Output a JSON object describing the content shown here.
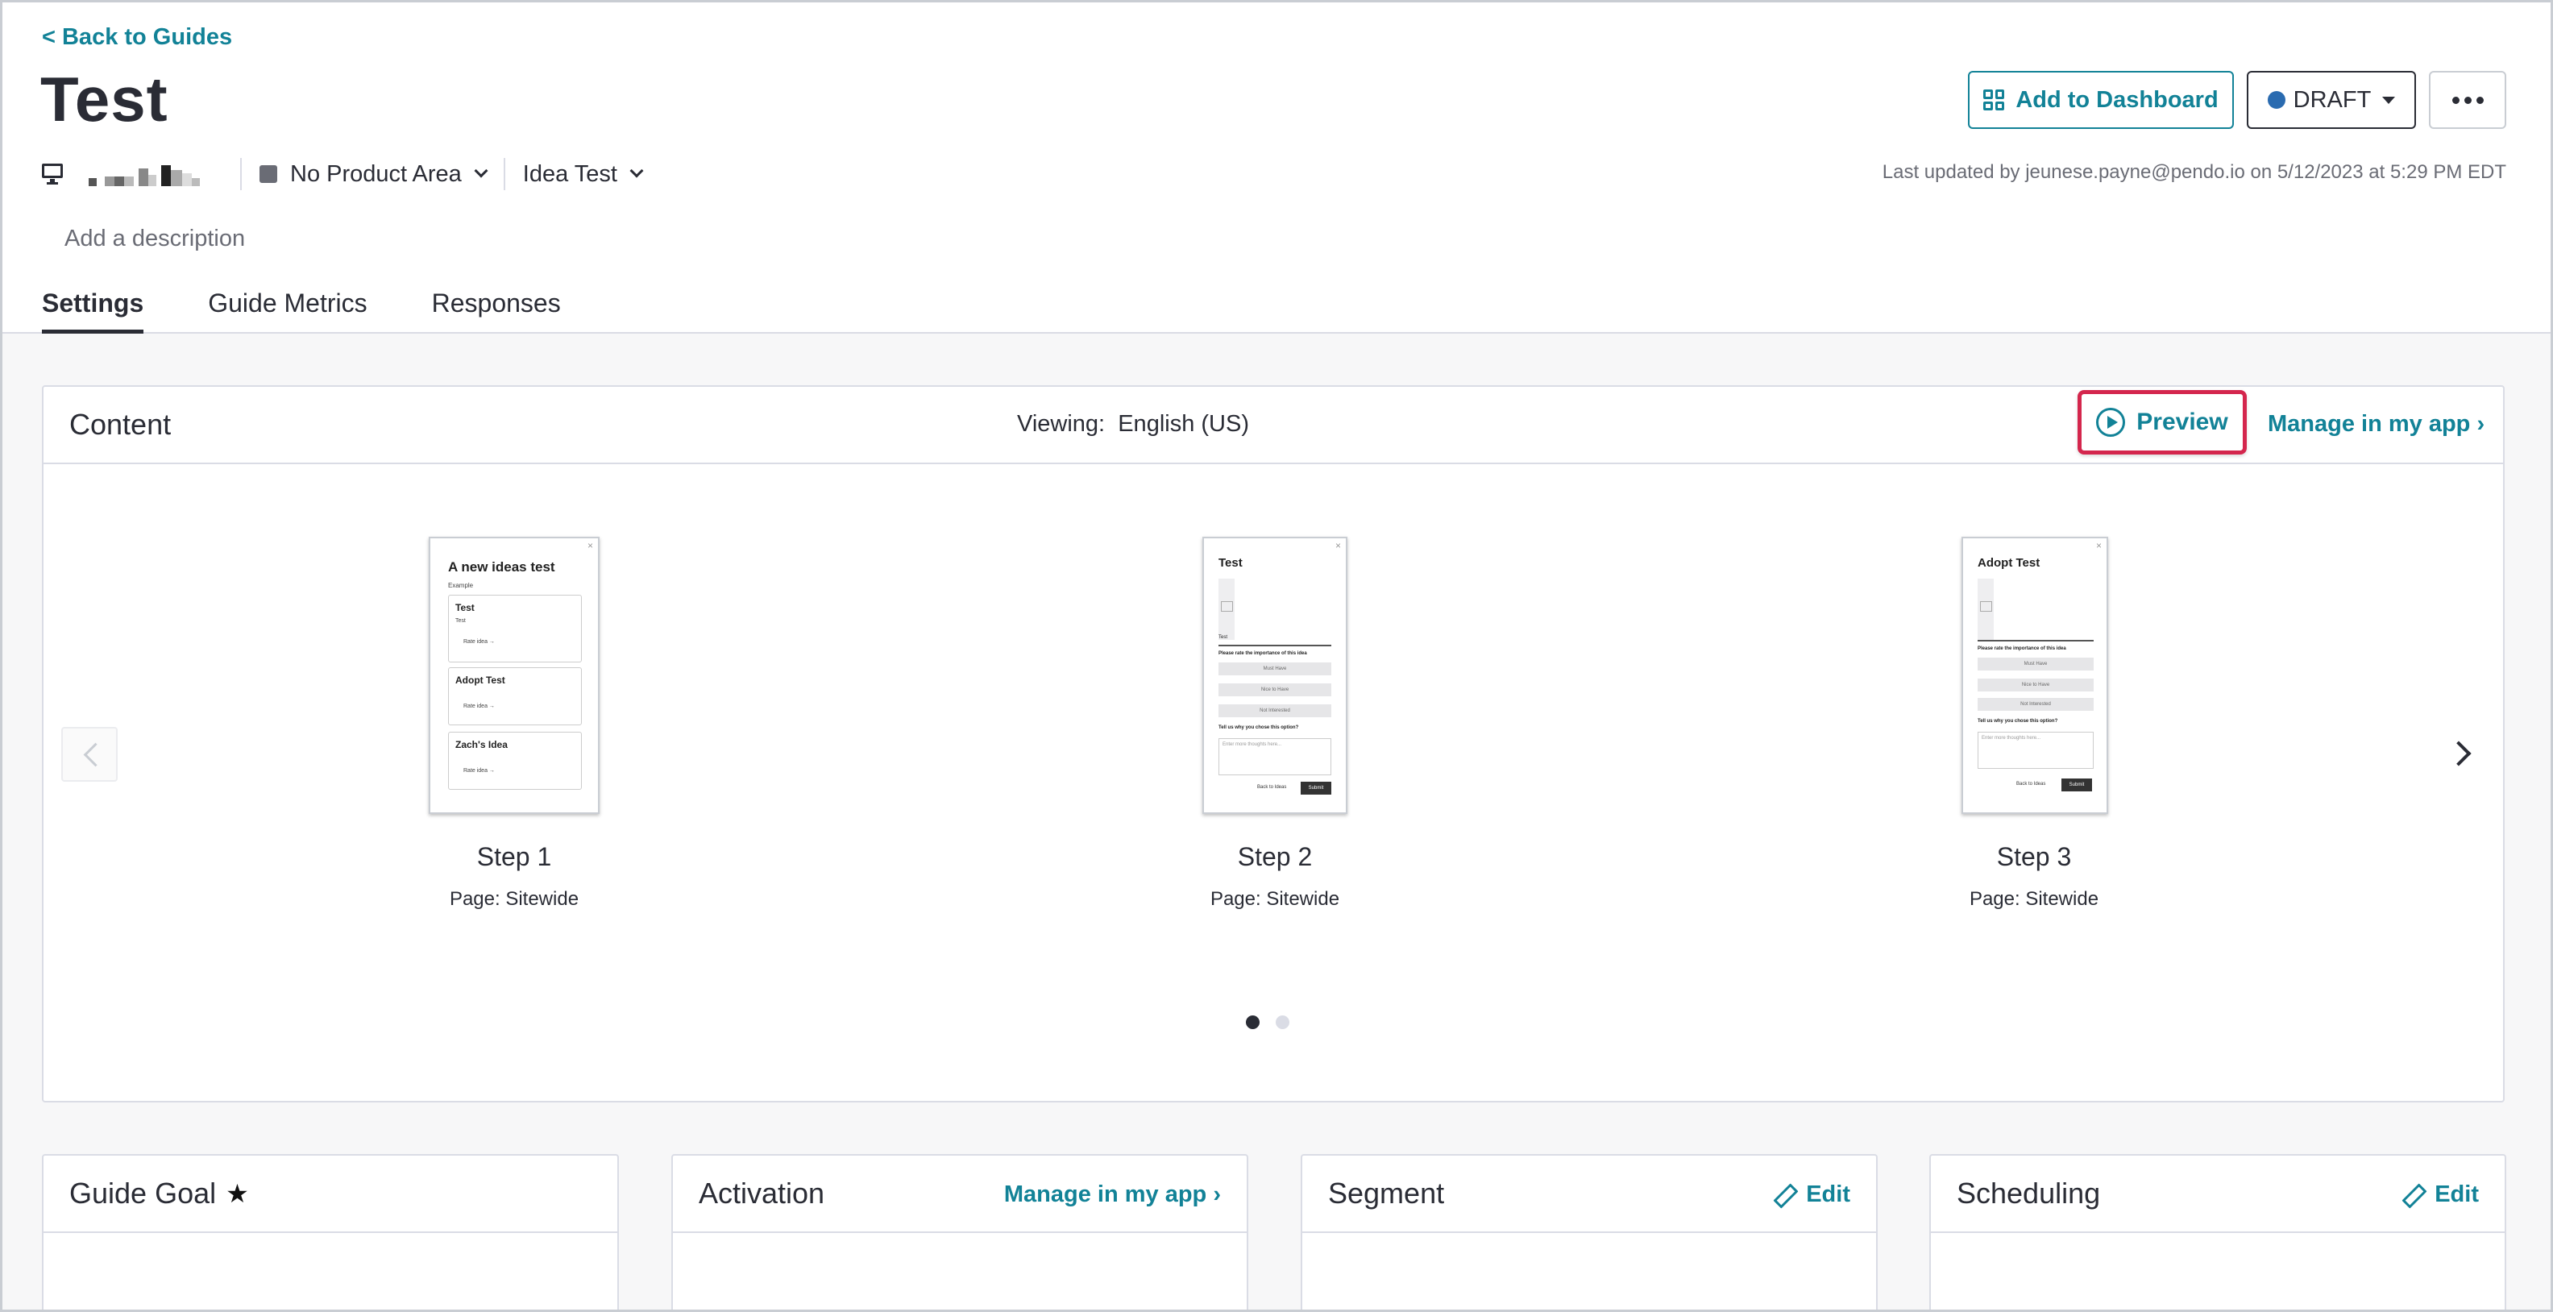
{
  "header": {
    "back_link": "< Back to Guides",
    "title": "Test",
    "add_dashboard_label": "Add to Dashboard",
    "draft_label": "DRAFT",
    "product_area_label": "No Product Area",
    "app_label": "Idea Test",
    "last_updated": "Last updated by jeunese.payne@pendo.io on 5/12/2023 at 5:29 PM EDT",
    "description_placeholder": "Add a description",
    "icons": {
      "platform": "desktop-monitor-icon",
      "more": "more-horizontal-icon",
      "dashboard": "dashboard-grid-icon"
    }
  },
  "tabs": [
    {
      "label": "Settings",
      "active": true
    },
    {
      "label": "Guide Metrics",
      "active": false
    },
    {
      "label": "Responses",
      "active": false
    }
  ],
  "content": {
    "title": "Content",
    "viewing_label": "Viewing:",
    "viewing_value": "English (US)",
    "preview_label": "Preview",
    "manage_label": "Manage in my app ›",
    "steps": [
      {
        "label": "Step 1",
        "page": "Page: Sitewide",
        "thumb": {
          "title": "A new ideas test",
          "subtitle": "Example",
          "cards": [
            {
              "title": "Test",
              "sub": "Test",
              "rate": "Rate idea →"
            },
            {
              "title": "Adopt Test",
              "sub": "",
              "rate": "Rate idea →"
            },
            {
              "title": "Zach's Idea",
              "sub": "",
              "rate": "Rate idea →"
            }
          ]
        }
      },
      {
        "label": "Step 2",
        "page": "Page: Sitewide",
        "thumb": {
          "title": "Test",
          "caption": "Test",
          "question": "Please rate the importance of this idea",
          "options": [
            "Must Have",
            "Nice to Have",
            "Not Interested"
          ],
          "why": "Tell us why you chose this option?",
          "placeholder": "Enter more thoughts here...",
          "back": "Back to Ideas",
          "submit": "Submit"
        }
      },
      {
        "label": "Step 3",
        "page": "Page: Sitewide",
        "thumb": {
          "title": "Adopt Test",
          "question": "Please rate the importance of this idea",
          "options": [
            "Must Have",
            "Nice to Have",
            "Not Interested"
          ],
          "why": "Tell us why you chose this option?",
          "placeholder": "Enter more thoughts here...",
          "back": "Back to Ideas",
          "submit": "Submit"
        }
      }
    ],
    "pager": {
      "pages": 2,
      "current": 1
    }
  },
  "cards": {
    "guide_goal": {
      "title": "Guide Goal"
    },
    "activation": {
      "title": "Activation",
      "link": "Manage in my app ›"
    },
    "segment": {
      "title": "Segment",
      "link": "Edit"
    },
    "scheduling": {
      "title": "Scheduling",
      "link": "Edit"
    }
  },
  "colors": {
    "accent": "#128297",
    "highlight": "#d4264d",
    "draft_dot": "#2a6bb0",
    "text": "#2a2c35"
  }
}
